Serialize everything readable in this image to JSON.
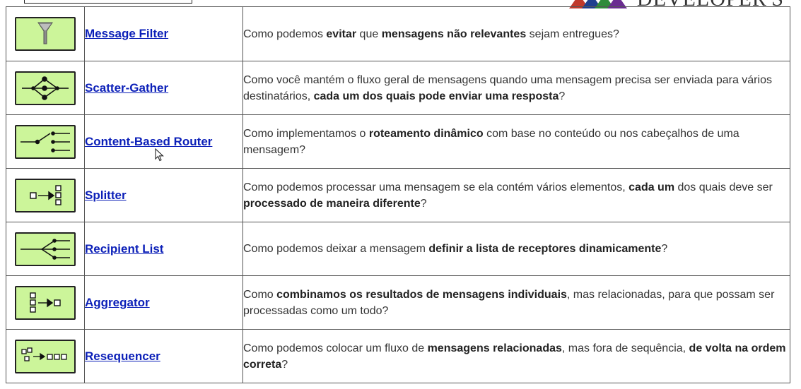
{
  "logo": {
    "text": "DEVELOPER'S"
  },
  "patterns": [
    {
      "name": "Message Filter",
      "icon": "filter-icon",
      "desc": [
        {
          "t": "Como podemos "
        },
        {
          "t": "evitar",
          "b": true
        },
        {
          "t": " que "
        },
        {
          "t": "mensagens não relevantes",
          "b": true
        },
        {
          "t": " sejam entregues?"
        }
      ]
    },
    {
      "name": "Scatter-Gather",
      "icon": "scatter-gather-icon",
      "desc": [
        {
          "t": "Como você mantém o fluxo geral de mensagens quando uma mensagem precisa ser enviada para vários destinatários, "
        },
        {
          "t": "cada um dos quais pode enviar uma resposta",
          "b": true
        },
        {
          "t": "?"
        }
      ]
    },
    {
      "name": "Content-Based Router",
      "icon": "content-router-icon",
      "desc": [
        {
          "t": "Como implementamos o "
        },
        {
          "t": "roteamento dinâmico",
          "b": true
        },
        {
          "t": " com base no conteúdo ou nos cabeçalhos de uma mensagem?"
        }
      ]
    },
    {
      "name": "Splitter",
      "icon": "splitter-icon",
      "desc": [
        {
          "t": "Como podemos processar uma mensagem se ela contém vários elementos, "
        },
        {
          "t": "cada um",
          "b": true
        },
        {
          "t": " dos quais deve ser "
        },
        {
          "t": "processado de maneira diferente",
          "b": true
        },
        {
          "t": "?"
        }
      ]
    },
    {
      "name": "Recipient List",
      "icon": "recipient-list-icon",
      "desc": [
        {
          "t": "Como podemos deixar a mensagem "
        },
        {
          "t": "definir a lista de receptores dinamicamente",
          "b": true
        },
        {
          "t": "?"
        }
      ]
    },
    {
      "name": "Aggregator",
      "icon": "aggregator-icon",
      "desc": [
        {
          "t": "Como "
        },
        {
          "t": "combinamos os resultados de mensagens individuais",
          "b": true
        },
        {
          "t": ", mas relacionadas, para que possam ser processadas como um todo?"
        }
      ]
    },
    {
      "name": "Resequencer",
      "icon": "resequencer-icon",
      "desc": [
        {
          "t": "Como podemos colocar um fluxo de "
        },
        {
          "t": "mensagens relacionadas",
          "b": true
        },
        {
          "t": ", mas fora de sequência, "
        },
        {
          "t": "de volta na ordem correta",
          "b": true
        },
        {
          "t": "?"
        }
      ]
    }
  ]
}
